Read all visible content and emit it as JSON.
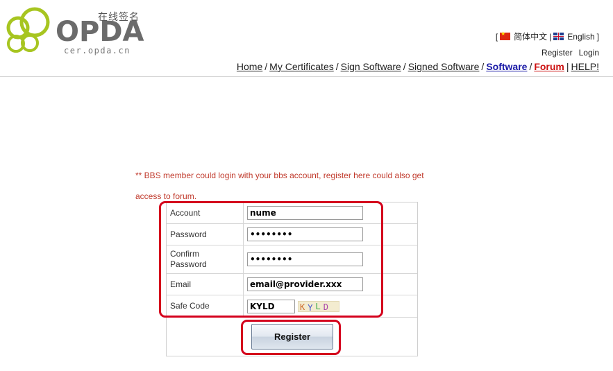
{
  "brand": {
    "logo_cn": "在线签名",
    "logo_word": "OPDA",
    "logo_sub": "cer.opda.cn"
  },
  "language": {
    "bracket_open": "[",
    "chinese": "简体中文",
    "separator": "|",
    "english": "English",
    "bracket_close": "]"
  },
  "account": {
    "register": "Register",
    "login": "Login"
  },
  "nav": {
    "home": "Home",
    "my_certificates": "My Certificates",
    "sign_software": "Sign Software",
    "signed_software": "Signed Software",
    "software": "Software",
    "forum": "Forum",
    "help": "HELP!",
    "sep_slash": "/",
    "sep_pipe": "|"
  },
  "notice": {
    "line1": "** BBS member could login with your bbs account, register here could also get",
    "line2": "access to forum."
  },
  "form": {
    "account_label": "Account",
    "account_value": "nume",
    "password_label": "Password",
    "password_value": "••••••••",
    "confirm_label_line1": "Confirm",
    "confirm_label_line2": "Password",
    "confirm_value": "••••••••",
    "email_label": "Email",
    "email_value": "email@provider.xxx",
    "safecode_label": "Safe Code",
    "safecode_value": "KYLD",
    "captcha_chars": [
      "K",
      "Y",
      "L",
      "D"
    ],
    "submit_label": "Register"
  },
  "colors": {
    "highlight": "#d4001c",
    "notice": "#c0392b",
    "software_link": "#1a1aa6",
    "forum_link": "#cc1111",
    "logo_green": "#a7c520"
  }
}
